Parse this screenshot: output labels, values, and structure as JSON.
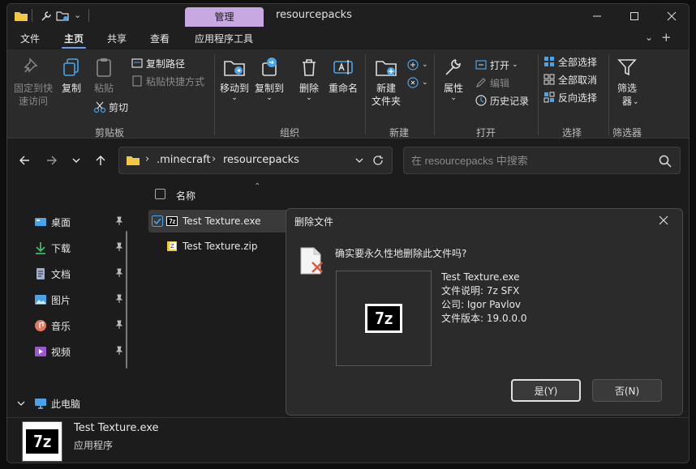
{
  "window": {
    "title": "resourcepacks",
    "manage_tab": "管理"
  },
  "menu": {
    "items": [
      "文件",
      "主页",
      "共享",
      "查看",
      "应用程序工具"
    ],
    "active": "主页"
  },
  "ribbon": {
    "pin_quick_access": "固定到快\n速访问",
    "copy": "复制",
    "paste": "粘贴",
    "copy_path": "复制路径",
    "paste_shortcut": "粘贴快捷方式",
    "cut": "剪切",
    "clipboard_group": "剪贴板",
    "move_to": "移动到",
    "copy_to": "复制到",
    "delete": "删除",
    "rename": "重命名",
    "organize_group": "组织",
    "new_folder": "新建\n文件夹",
    "new_group": "新建",
    "properties": "属性",
    "open": "打开",
    "edit": "编辑",
    "history": "历史记录",
    "open_group": "打开",
    "select_all": "全部选择",
    "select_none": "全部取消",
    "invert_selection": "反向选择",
    "select_group": "选择",
    "filter": "筛选\n器",
    "filter_group": "筛选器"
  },
  "address": {
    "crumbs": [
      ".minecraft",
      "resourcepacks"
    ],
    "search_placeholder": "在 resourcepacks 中搜索"
  },
  "sidebar": {
    "items": [
      {
        "label": "桌面",
        "icon": "desktop-icon",
        "color": "#4aa3e8"
      },
      {
        "label": "下载",
        "icon": "download-icon",
        "color": "#3fb86a"
      },
      {
        "label": "文档",
        "icon": "document-icon",
        "color": "#9fb0c8"
      },
      {
        "label": "图片",
        "icon": "pictures-icon",
        "color": "#4aa3e8"
      },
      {
        "label": "音乐",
        "icon": "music-icon",
        "color": "#e07a5f"
      },
      {
        "label": "视频",
        "icon": "video-icon",
        "color": "#9b59d0"
      }
    ],
    "this_pc": "此电脑"
  },
  "filelist": {
    "column_name": "名称",
    "files": [
      {
        "name": "Test Texture.exe",
        "selected": true
      },
      {
        "name": "Test Texture.zip",
        "selected": false
      }
    ]
  },
  "preview": {
    "name": "Test Texture.exe",
    "type": "应用程序",
    "icon_text": "7z"
  },
  "dialog": {
    "title": "删除文件",
    "question": "确实要永久性地删除此文件吗?",
    "file_name": "Test Texture.exe",
    "description": "文件说明: 7z SFX",
    "company": "公司: Igor Pavlov",
    "version": "文件版本: 19.0.0.0",
    "icon_text": "7z",
    "yes": "是(Y)",
    "no": "否(N)"
  }
}
